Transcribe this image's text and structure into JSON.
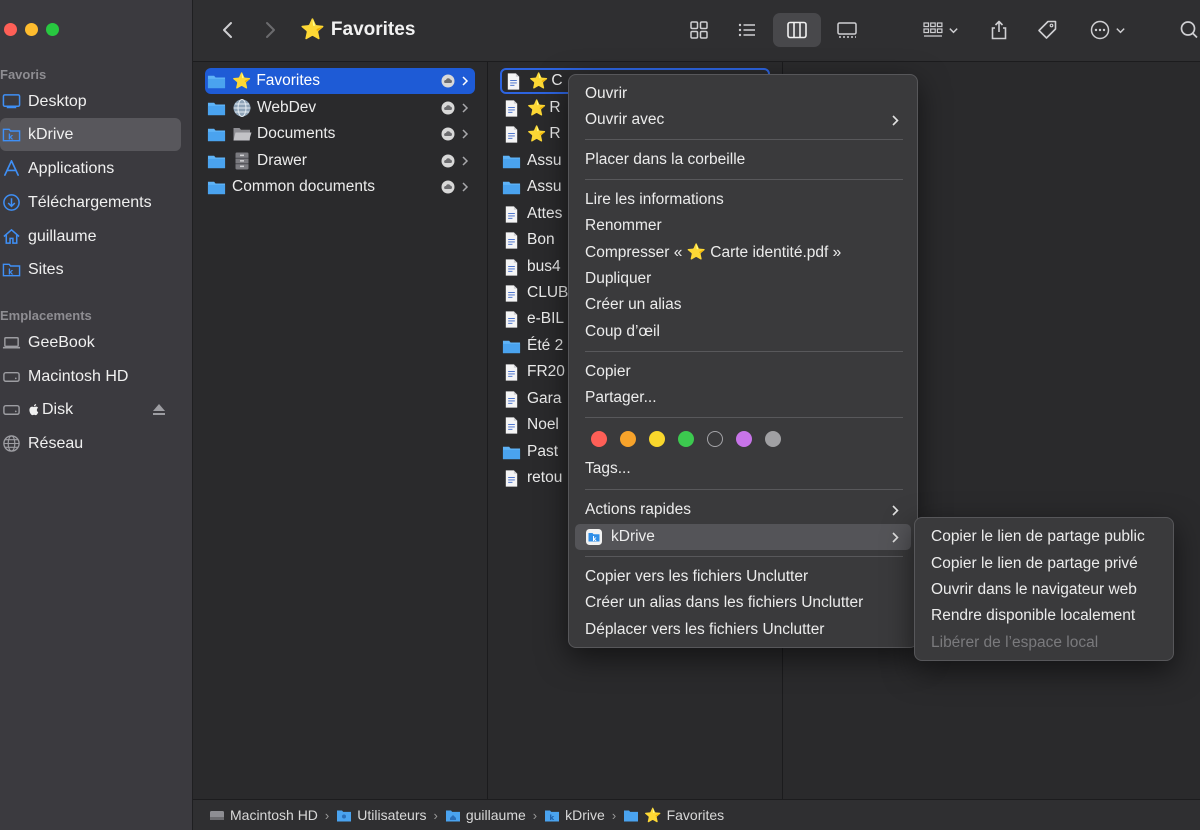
{
  "toolbar": {
    "title": "Favorites"
  },
  "sidebar": {
    "sections": {
      "favorites": "Favoris",
      "locations": "Emplacements"
    },
    "favorites": [
      {
        "label": "Desktop",
        "icon": "desktop-icon"
      },
      {
        "label": "kDrive",
        "icon": "kdrive-folder-icon",
        "active": true
      },
      {
        "label": "Applications",
        "icon": "applications-icon"
      },
      {
        "label": "Téléchargements",
        "icon": "downloads-icon"
      },
      {
        "label": "guillaume",
        "icon": "home-icon"
      },
      {
        "label": "Sites",
        "icon": "sites-folder-icon"
      }
    ],
    "locations": [
      {
        "label": "GeeBook",
        "icon": "laptop-icon"
      },
      {
        "label": "Macintosh HD",
        "icon": "disk-icon"
      },
      {
        "label": " Disk",
        "icon": "disk-icon"
      },
      {
        "label": "Réseau",
        "icon": "network-icon"
      }
    ]
  },
  "column1": [
    {
      "label": "Favorites",
      "icon": "star",
      "selected": true
    },
    {
      "label": "WebDev",
      "icon": "globe"
    },
    {
      "label": "Documents",
      "icon": "folder-open"
    },
    {
      "label": "Drawer",
      "icon": "cabinet"
    },
    {
      "label": "Common documents",
      "icon": "folder"
    }
  ],
  "column2": [
    {
      "label": "C",
      "icon": "doc-star"
    },
    {
      "label": "R",
      "icon": "doc-star"
    },
    {
      "label": "R",
      "icon": "doc-star"
    },
    {
      "label": "Assu",
      "icon": "folder"
    },
    {
      "label": "Assu",
      "icon": "folder"
    },
    {
      "label": "Attes",
      "icon": "doc"
    },
    {
      "label": "Bon",
      "icon": "doc"
    },
    {
      "label": "bus4",
      "icon": "doc"
    },
    {
      "label": "CLUB",
      "icon": "doc"
    },
    {
      "label": "e-BIL",
      "icon": "doc"
    },
    {
      "label": "Été 2",
      "icon": "folder"
    },
    {
      "label": "FR20",
      "icon": "doc"
    },
    {
      "label": "Gara",
      "icon": "doc"
    },
    {
      "label": "Noel",
      "icon": "doc"
    },
    {
      "label": "Past",
      "icon": "folder"
    },
    {
      "label": "retou",
      "icon": "doc"
    }
  ],
  "context_menu": {
    "open": "Ouvrir",
    "open_with": "Ouvrir avec",
    "trash": "Placer dans la corbeille",
    "get_info": "Lire les informations",
    "rename": "Renommer",
    "compress": "Compresser « ⭐️ Carte identité.pdf »",
    "duplicate": "Dupliquer",
    "make_alias": "Créer un alias",
    "quick_look": "Coup d’œil",
    "copy": "Copier",
    "share": "Partager...",
    "tags": "Tags...",
    "quick_actions": "Actions rapides",
    "kdrive": "kDrive",
    "copy_to_unclutter": "Copier vers les fichiers Unclutter",
    "alias_unclutter": "Créer un alias dans les fichiers Unclutter",
    "move_to_unclutter": "Déplacer vers les fichiers Unclutter",
    "tag_colors": [
      "#fe5f57",
      "#f7a32b",
      "#f9d72c",
      "#3cc94f",
      "transparent",
      "#c774e8",
      "#a0a0a3"
    ]
  },
  "kdrive_submenu": {
    "copy_public": "Copier le lien de partage public",
    "copy_private": "Copier le lien de partage privé",
    "open_web": "Ouvrir dans le navigateur web",
    "make_local": "Rendre disponible localement",
    "free_space": "Libérer de l’espace local"
  },
  "pathbar": [
    {
      "label": "Macintosh HD",
      "icon": "disk-icon"
    },
    {
      "label": "Utilisateurs",
      "icon": "folder-icon"
    },
    {
      "label": "guillaume",
      "icon": "home-folder-icon"
    },
    {
      "label": "kDrive",
      "icon": "kdrive-folder-icon"
    },
    {
      "label": "Favorites",
      "icon": "folder-icon"
    }
  ]
}
